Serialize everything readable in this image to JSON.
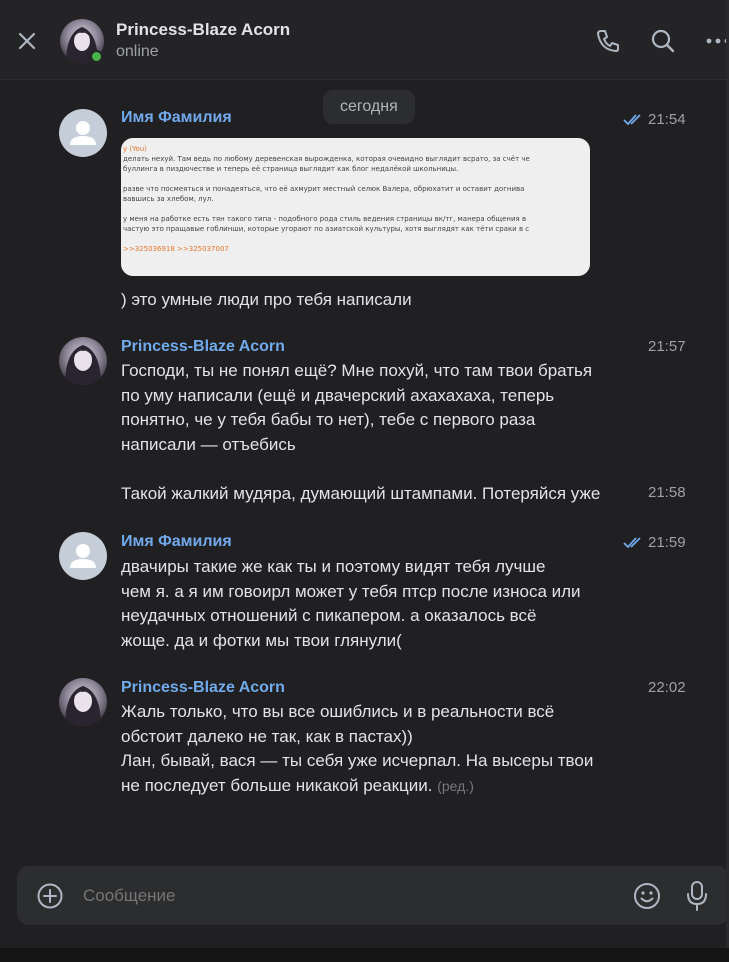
{
  "header": {
    "contact_name": "Princess-Blaze Acorn",
    "status": "online"
  },
  "feed": {
    "date_divider": "сегодня",
    "messages": [
      {
        "author": "Имя Фамилия",
        "time": "21:54",
        "read": true,
        "screenshot_lines": [
          "у (You)",
          "делать нехуй. Там ведь по любому деревенская вырожденка, которая очевидно выглядит всрато, за счёт че",
          "буллинга в пиздючестве и теперь её страница выглядит как блог недалёкой школьницы.",
          "",
          "разве что посмеяться и понадеяться, что её ахмурит местный селюк Валера, обрюхатит и оставит догнива",
          "вавшись за хлебом, лул.",
          "",
          "у меня на работке есть тян такого типа - подобного рода стиль ведения страницы вк/тг, манера общения в",
          "частую это пращавые гоблинши, которые угорают по азиатской культуры, хотя выглядят как тёти сраки в с",
          "",
          ">>325036918 >>325037007"
        ],
        "text": ") это умные люди про тебя написали"
      },
      {
        "author": "Princess-Blaze Acorn",
        "time": "21:57",
        "lines": [
          "Господи, ты не понял ещё? Мне похуй, что там твои братья",
          "по уму написали (ещё и двачерский ахахахаха, теперь",
          "понятно, че у тебя бабы то нет), тебе с первого раза",
          "написали — отъебись"
        ]
      },
      {
        "author": "",
        "time": "21:58",
        "text": "Такой жалкий мудяра, думающий штампами. Потеряйся уже"
      },
      {
        "author": "Имя Фамилия",
        "time": "21:59",
        "read": true,
        "lines": [
          "двачиры такие же как ты и поэтому видят тебя лучше",
          "чем я. а я им говоирл может у тебя птср после износа или",
          "неудачных отношений с пикапером. а оказалось всё",
          "жоще. да и фотки мы твои глянули("
        ]
      },
      {
        "author": "Princess-Blaze Acorn",
        "time": "22:02",
        "lines": [
          "Жаль только, что вы все ошиблись и в реальности всё",
          "обстоит далеко не так, как в пастах))",
          "Лан, бывай, вася — ты себя уже исчерпал. На высеры твои",
          "не последует больше никакой реакции."
        ],
        "edited_mark": "(ред.)"
      }
    ]
  },
  "composer": {
    "placeholder": "Сообщение"
  },
  "icons": {
    "close": "close-icon",
    "call": "phone-icon",
    "search": "search-icon",
    "more": "more-icon",
    "attach": "plus-circle-icon",
    "emoji": "smile-icon",
    "voice": "mic-icon",
    "read_receipt": "double-check-icon"
  },
  "colors": {
    "accent": "#71aaeb",
    "online": "#4bb34b",
    "background": "#202022"
  }
}
